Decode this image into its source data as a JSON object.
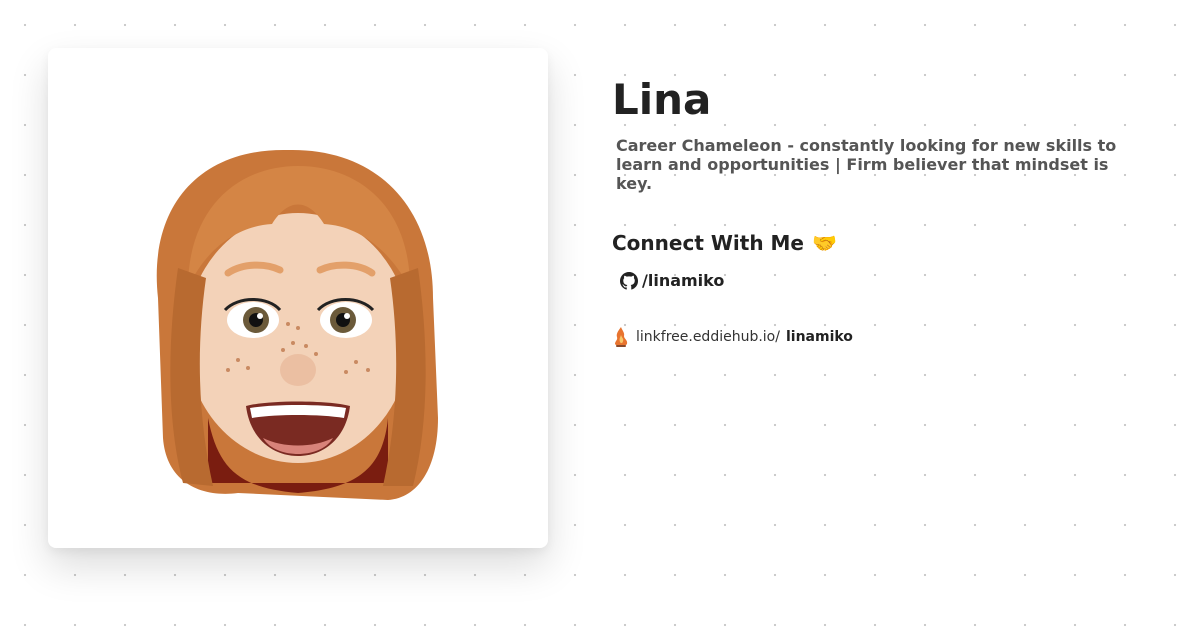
{
  "profile": {
    "name": "Lina",
    "bio": "Career Chameleon - constantly looking for new skills to learn and opportunities | Firm believer that mindset is key."
  },
  "connect": {
    "heading": "Connect With Me",
    "emoji": "🤝",
    "links": [
      {
        "icon": "github-icon",
        "label": "/linamiko"
      }
    ]
  },
  "footer": {
    "icon": "linkfree-logo-icon",
    "domain": "linkfree.eddiehub.io/",
    "username": "linamiko"
  }
}
